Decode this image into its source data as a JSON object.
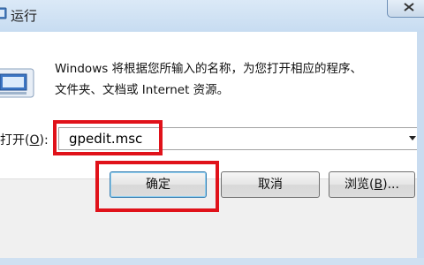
{
  "window": {
    "title": "运行",
    "title_icon": "run-icon",
    "close_icon": "close-icon"
  },
  "dialog": {
    "description_line1": "Windows 将根据您所输入的名称，为您打开相应的程序、",
    "description_line2": "文件夹、文档或 Internet 资源。",
    "command_icon": "run-command-icon"
  },
  "open_field": {
    "label_prefix": "打开(",
    "label_hotkey": "O",
    "label_suffix": "):",
    "value": "gpedit.msc"
  },
  "buttons": {
    "ok_label": "确定",
    "cancel_label": "取消",
    "browse_prefix": "浏览(",
    "browse_hotkey": "B",
    "browse_suffix": ")..."
  },
  "colors": {
    "highlight": "#e0121a",
    "titlebar": "#c7dcf1",
    "button_focus": "#3c7fb1"
  }
}
